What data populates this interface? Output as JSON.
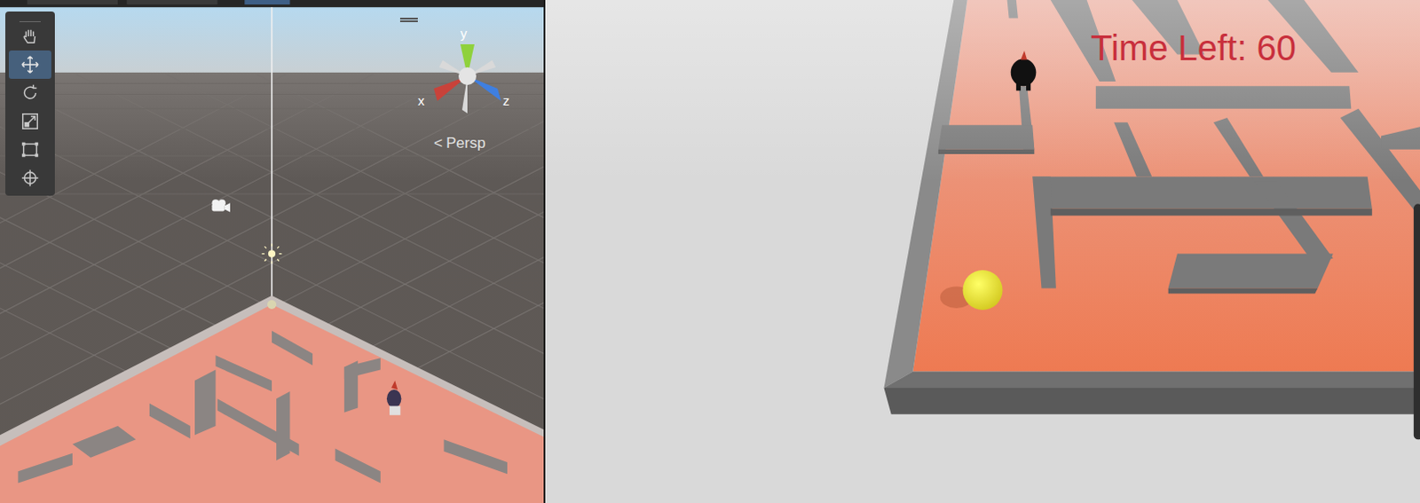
{
  "scene_view": {
    "tools": [
      {
        "kind": "hand",
        "selected": false
      },
      {
        "kind": "move",
        "selected": true
      },
      {
        "kind": "rotate",
        "selected": false
      },
      {
        "kind": "scale",
        "selected": false
      },
      {
        "kind": "rect",
        "selected": false
      },
      {
        "kind": "transform",
        "selected": false
      }
    ],
    "gizmo": {
      "axes": [
        {
          "label": "x",
          "color": "#c8423a"
        },
        {
          "label": "y",
          "color": "#8fd13c"
        },
        {
          "label": "z",
          "color": "#3f7fe0"
        }
      ]
    },
    "projection": {
      "icon": "<",
      "label": "Persp"
    }
  },
  "game_view": {
    "timer": "Time Left: 60"
  }
}
